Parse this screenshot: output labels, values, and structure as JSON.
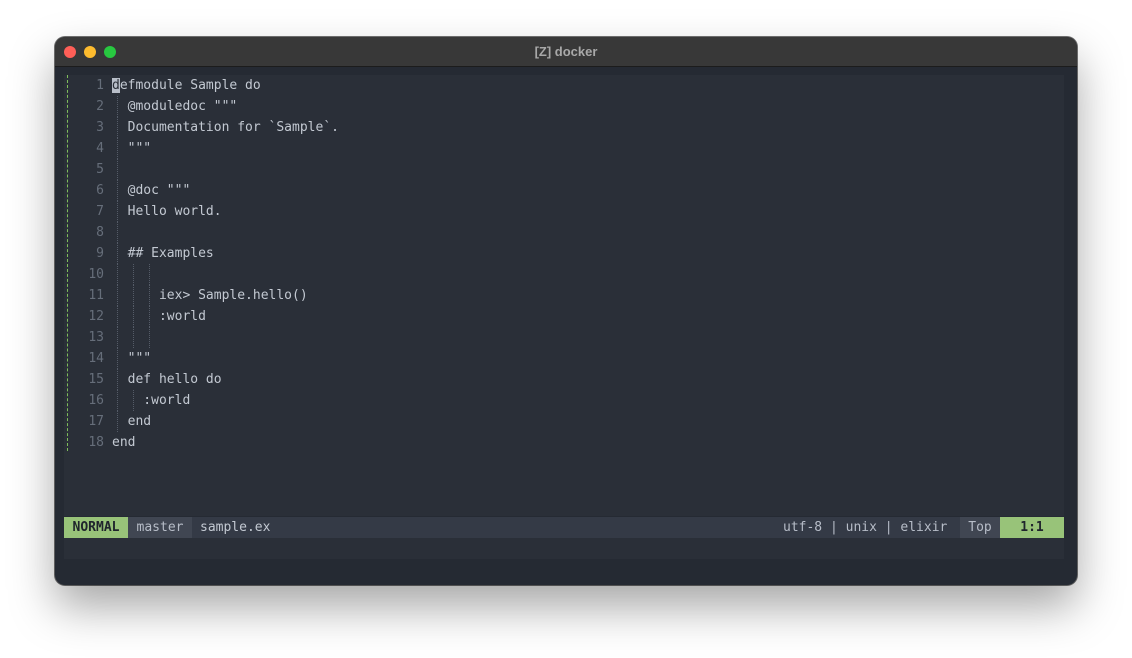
{
  "window": {
    "title": "[Z] docker"
  },
  "editor": {
    "lines": [
      {
        "n": "1",
        "text": "defmodule Sample do"
      },
      {
        "n": "2",
        "text": "  @moduledoc \"\"\""
      },
      {
        "n": "3",
        "text": "  Documentation for `Sample`."
      },
      {
        "n": "4",
        "text": "  \"\"\""
      },
      {
        "n": "5",
        "text": ""
      },
      {
        "n": "6",
        "text": "  @doc \"\"\""
      },
      {
        "n": "7",
        "text": "  Hello world."
      },
      {
        "n": "8",
        "text": ""
      },
      {
        "n": "9",
        "text": "  ## Examples"
      },
      {
        "n": "10",
        "text": ""
      },
      {
        "n": "11",
        "text": "      iex> Sample.hello()"
      },
      {
        "n": "12",
        "text": "      :world"
      },
      {
        "n": "13",
        "text": ""
      },
      {
        "n": "14",
        "text": "  \"\"\""
      },
      {
        "n": "15",
        "text": "  def hello do"
      },
      {
        "n": "16",
        "text": "    :world"
      },
      {
        "n": "17",
        "text": "  end"
      },
      {
        "n": "18",
        "text": "end"
      }
    ]
  },
  "statusline": {
    "mode": "NORMAL",
    "branch": "master",
    "filename": "sample.ex",
    "fileinfo": "utf-8 | unix | elixir",
    "scroll": "Top",
    "position": "1:1"
  },
  "colors": {
    "accent": "#98c379",
    "background": "#2a2f38"
  }
}
